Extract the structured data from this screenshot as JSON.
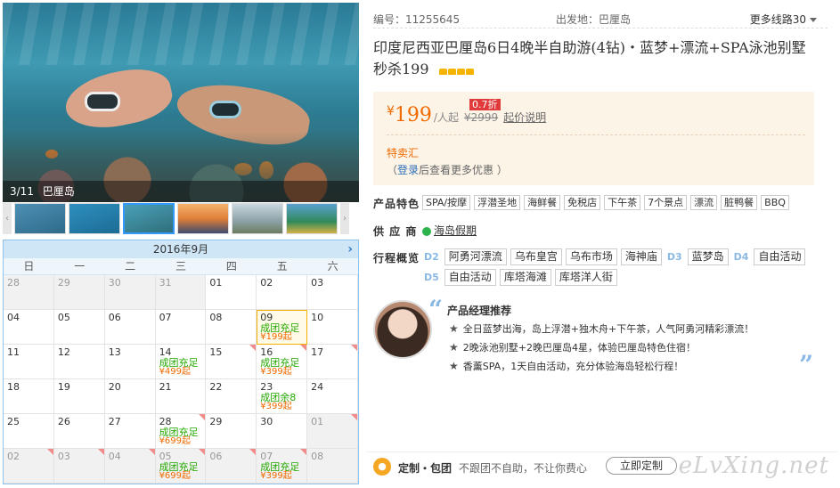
{
  "gallery": {
    "counter": "3/11",
    "location": "巴厘岛"
  },
  "calendar": {
    "month_label": "2016年9月",
    "weekdays": [
      "日",
      "一",
      "二",
      "三",
      "四",
      "五",
      "六"
    ],
    "cells": [
      {
        "day": "28",
        "other": true
      },
      {
        "day": "29",
        "other": true
      },
      {
        "day": "30",
        "other": true
      },
      {
        "day": "31",
        "other": true
      },
      {
        "day": "01"
      },
      {
        "day": "02"
      },
      {
        "day": "03"
      },
      {
        "day": "04"
      },
      {
        "day": "05"
      },
      {
        "day": "06"
      },
      {
        "day": "07"
      },
      {
        "day": "08"
      },
      {
        "day": "09",
        "status": "成团充足",
        "price": "¥199起",
        "selected": true
      },
      {
        "day": "10"
      },
      {
        "day": "11"
      },
      {
        "day": "12"
      },
      {
        "day": "13"
      },
      {
        "day": "14",
        "status": "成团充足",
        "price": "¥499起"
      },
      {
        "day": "15",
        "corner": true
      },
      {
        "day": "16",
        "status": "成团充足",
        "price": "¥399起",
        "corner": true
      },
      {
        "day": "17",
        "corner": true
      },
      {
        "day": "18"
      },
      {
        "day": "19"
      },
      {
        "day": "20"
      },
      {
        "day": "21"
      },
      {
        "day": "22"
      },
      {
        "day": "23",
        "status": "成团余8",
        "price": "¥399起"
      },
      {
        "day": "24"
      },
      {
        "day": "25"
      },
      {
        "day": "26"
      },
      {
        "day": "27"
      },
      {
        "day": "28",
        "status": "成团充足",
        "price": "¥699起",
        "corner": true
      },
      {
        "day": "29"
      },
      {
        "day": "30"
      },
      {
        "day": "01",
        "other": true,
        "corner": true
      },
      {
        "day": "02",
        "other": true,
        "corner": true
      },
      {
        "day": "03",
        "other": true,
        "corner": true
      },
      {
        "day": "04",
        "other": true,
        "corner": true
      },
      {
        "day": "05",
        "status": "成团充足",
        "price": "¥699起",
        "other": true,
        "corner": true
      },
      {
        "day": "06",
        "other": true,
        "corner": true
      },
      {
        "day": "07",
        "status": "成团充足",
        "price": "¥399起",
        "other": true,
        "corner": true
      },
      {
        "day": "08",
        "other": true
      }
    ]
  },
  "meta": {
    "product_id": "编号：11255645",
    "departure": "出发地：巴厘岛",
    "more_routes": "更多线路30"
  },
  "title": "印度尼西亚巴厘岛6日4晚半自助游(4钻)・蓝梦+漂流+SPA泳池别墅 秒杀199",
  "price": {
    "currency": "¥",
    "value": "199",
    "per": "/人起",
    "original": "¥2999",
    "note": "起价说明",
    "discount": "0.7折",
    "special": "特卖汇",
    "login_link": "登录",
    "login_text": "后查看更多优惠 ）",
    "login_paren": "（"
  },
  "features": {
    "label": "产品特色",
    "tags": [
      "SPA/按摩",
      "浮潜圣地",
      "海鲜餐",
      "免税店",
      "下午茶",
      "7个景点",
      "漂流",
      "脏鸭餐",
      "BBQ"
    ]
  },
  "supplier": {
    "label": "供 应 商",
    "name": "海岛假期"
  },
  "itinerary": {
    "label": "行程概览",
    "items": [
      {
        "kind": "day",
        "text": "D2"
      },
      {
        "kind": "spot",
        "text": "阿勇河漂流"
      },
      {
        "kind": "spot",
        "text": "乌布皇宫"
      },
      {
        "kind": "spot",
        "text": "乌布市场"
      },
      {
        "kind": "spot",
        "text": "海神庙"
      },
      {
        "kind": "day",
        "text": "D3"
      },
      {
        "kind": "spot",
        "text": "蓝梦岛"
      },
      {
        "kind": "day",
        "text": "D4"
      },
      {
        "kind": "spot",
        "text": "自由活动"
      },
      {
        "kind": "day",
        "text": "D5"
      },
      {
        "kind": "spot",
        "text": "自由活动"
      },
      {
        "kind": "spot",
        "text": "库塔海滩"
      },
      {
        "kind": "spot",
        "text": "库塔洋人街"
      }
    ]
  },
  "manager": {
    "title": "产品经理推荐",
    "points": [
      "全日蓝梦出海，岛上浮潜+独木舟+下午茶，人气阿勇河精彩漂流！",
      "2晚泳池别墅+2晚巴厘岛4星，体验巴厘岛特色住宿！",
      "香薰SPA，1天自由活动，充分体验海岛轻松行程！"
    ]
  },
  "custom": {
    "label": "定制・包团",
    "desc": "不跟团不自助，不让你费心",
    "button": "立即定制"
  },
  "watermark": "eLvXing.net"
}
